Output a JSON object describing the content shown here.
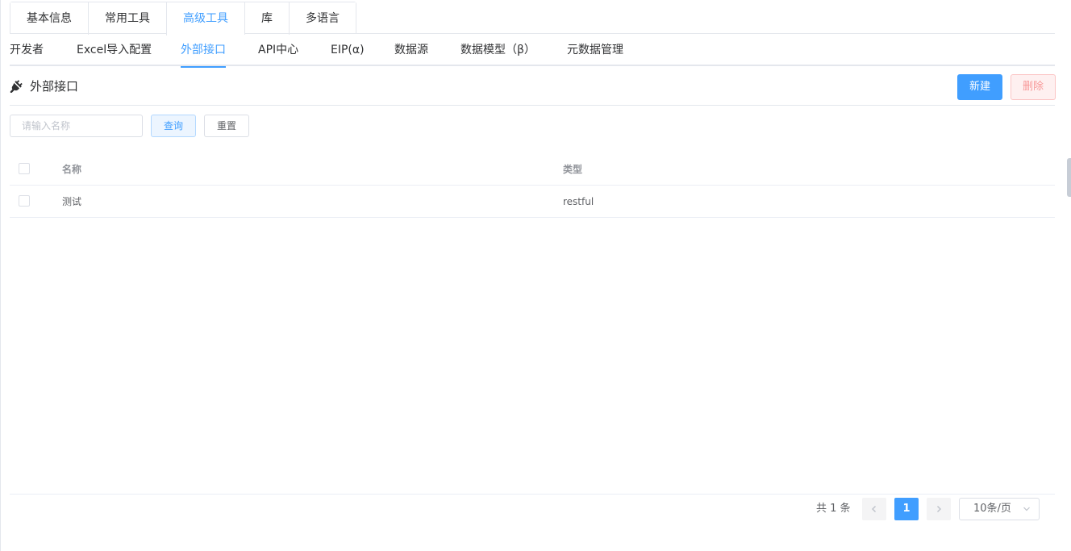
{
  "top_tabs": [
    "基本信息",
    "常用工具",
    "高级工具",
    "库",
    "多语言"
  ],
  "sub_tabs": [
    "开发者",
    "Excel导入配置",
    "外部接口",
    "API中心",
    "EIP(α)",
    "数据源",
    "数据模型（β）",
    "元数据管理"
  ],
  "section": {
    "icon": "plug-icon",
    "title": "外部接口",
    "new_label": "新建",
    "delete_label": "删除"
  },
  "search": {
    "placeholder": "请输入名称",
    "value": "",
    "query_label": "查询",
    "reset_label": "重置"
  },
  "table": {
    "headers": [
      "名称",
      "类型"
    ],
    "rows": [
      {
        "name": "测试",
        "type": "restful"
      }
    ]
  },
  "pagination": {
    "total_text": "共 1 条",
    "current_page": "1",
    "page_size": "10条/页"
  },
  "colors": {
    "primary": "#409eff",
    "danger_light": "#fef0f0"
  }
}
